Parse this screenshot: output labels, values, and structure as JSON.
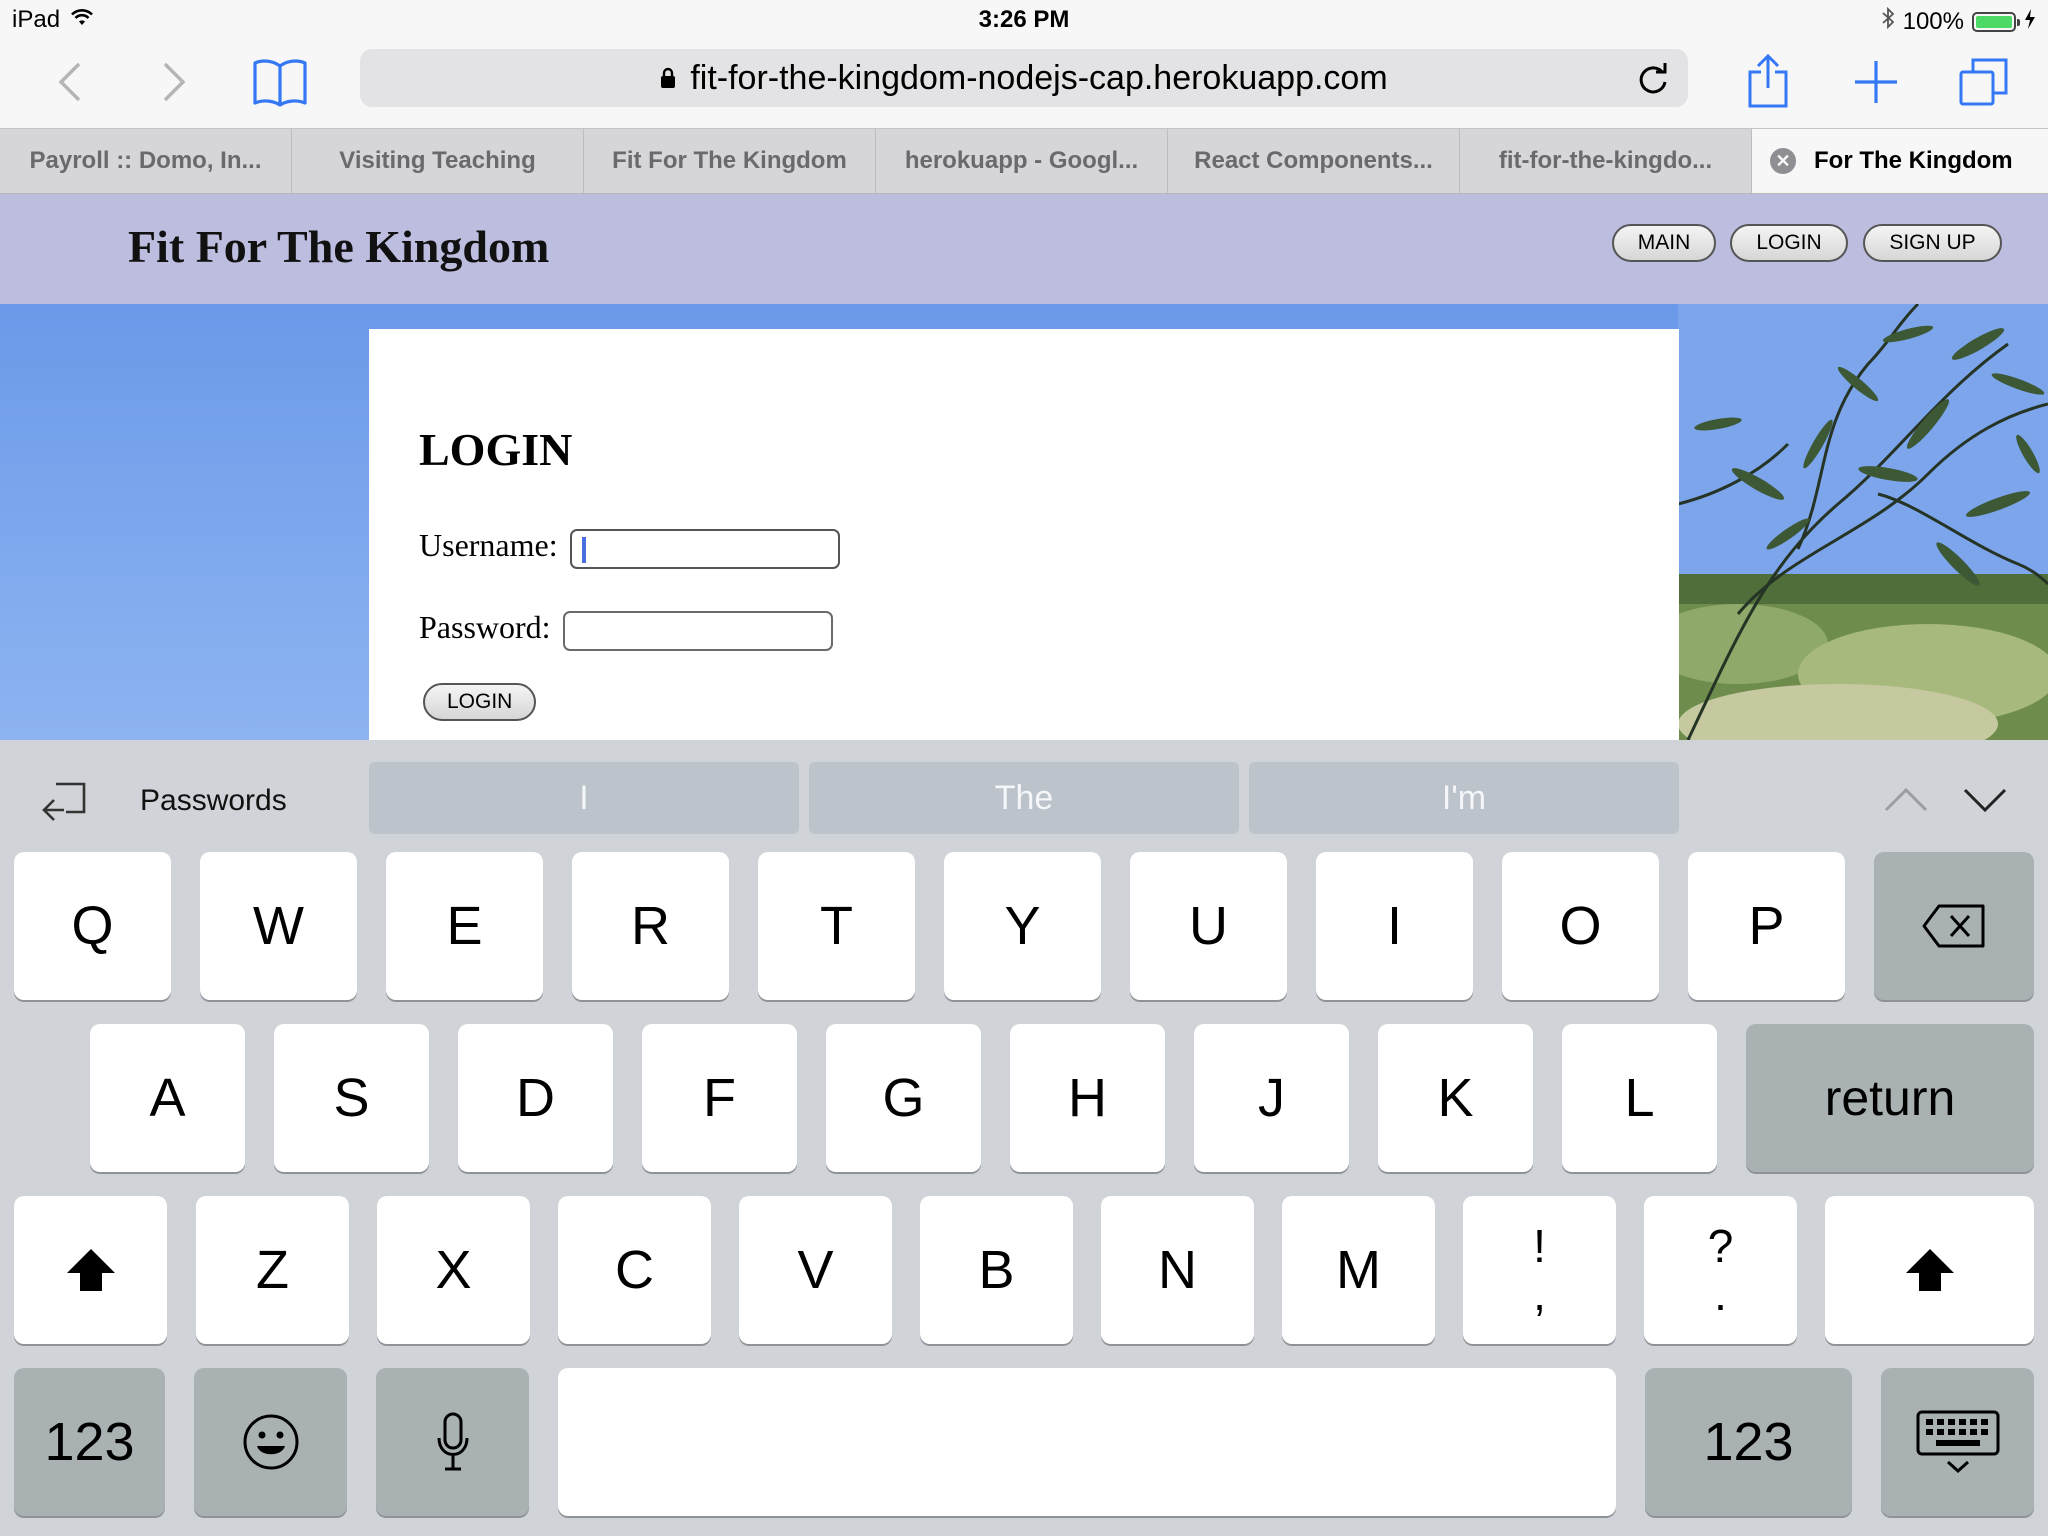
{
  "status_bar": {
    "device": "iPad",
    "time": "3:26 PM",
    "battery": "100%",
    "icons": [
      "wifi-icon",
      "bluetooth-icon",
      "battery-icon",
      "charging-icon"
    ]
  },
  "toolbar": {
    "url": "fit-for-the-kingdom-nodejs-cap.herokuapp.com",
    "icons": [
      "back-icon",
      "forward-icon",
      "bookmarks-icon",
      "lock-icon",
      "reload-icon",
      "share-icon",
      "new-tab-icon",
      "tabs-icon"
    ]
  },
  "tabs": [
    {
      "label": "Payroll :: Domo, In..."
    },
    {
      "label": "Visiting Teaching"
    },
    {
      "label": "Fit For The Kingdom"
    },
    {
      "label": "herokuapp - Googl..."
    },
    {
      "label": "React Components..."
    },
    {
      "label": "fit-for-the-kingdo..."
    },
    {
      "label": "For The Kingdom",
      "active": true
    }
  ],
  "site": {
    "title": "Fit For The Kingdom",
    "nav": {
      "main": "MAIN",
      "login": "LOGIN",
      "signup": "SIGN UP"
    }
  },
  "login_form": {
    "heading": "LOGIN",
    "username_label": "Username:",
    "password_label": "Password:",
    "username_value": "",
    "password_value": "",
    "submit_label": "LOGIN"
  },
  "keyboard": {
    "passwords_label": "Passwords",
    "suggestions": [
      "I",
      "The",
      "I'm"
    ],
    "row1": [
      "Q",
      "W",
      "E",
      "R",
      "T",
      "Y",
      "U",
      "I",
      "O",
      "P"
    ],
    "row2": [
      "A",
      "S",
      "D",
      "F",
      "G",
      "H",
      "J",
      "K",
      "L"
    ],
    "return_label": "return",
    "row3": [
      "Z",
      "X",
      "C",
      "V",
      "B",
      "N",
      "M"
    ],
    "punct1": [
      "!",
      ","
    ],
    "punct2": [
      "?",
      "."
    ],
    "numbers_label": "123",
    "colors": {
      "key": "#ffffff",
      "dark_key": "#a9b1b3",
      "background": "#d0d4d8"
    }
  },
  "colors": {
    "site_header": "#bdbde0",
    "sky": "#6e9bea",
    "caret": "#4a6fe0",
    "ios_blue": "#3478f6"
  }
}
